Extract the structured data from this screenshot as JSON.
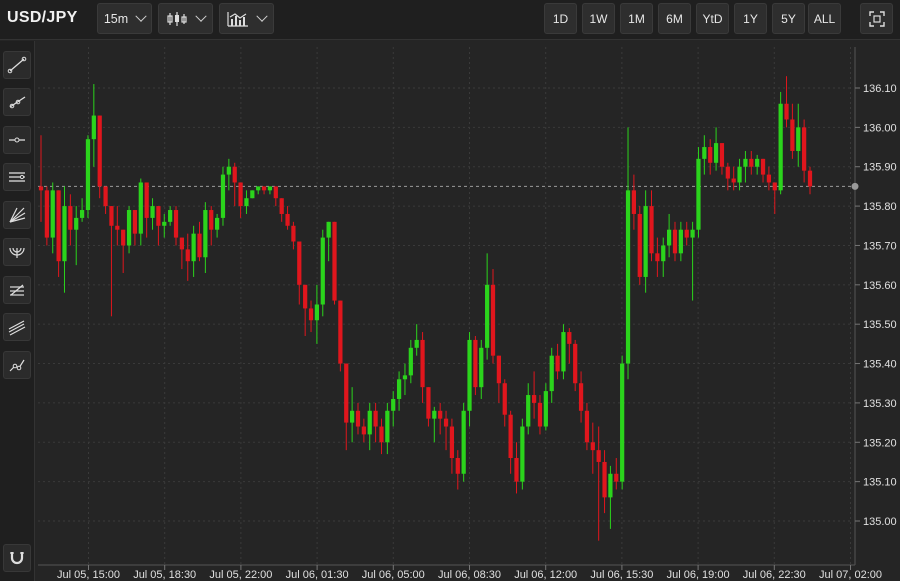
{
  "header": {
    "symbol": "USD/JPY",
    "interval": "15m",
    "chart_type_icon": "candlestick-icon",
    "indicators_icon": "indicators-icon",
    "ranges": [
      "1D",
      "1W",
      "1M",
      "6M",
      "YtD",
      "1Y",
      "5Y",
      "ALL"
    ],
    "fullscreen_icon": "fullscreen-icon"
  },
  "sidebar": {
    "tools": [
      "trend-line-icon",
      "ray-icon",
      "horizontal-line-icon",
      "parallel-channel-icon",
      "fan-icon",
      "arc-icon",
      "fib-retracement-icon",
      "channel-lines-icon",
      "path-icon"
    ],
    "bottom_tool": "magnet-icon"
  },
  "colors": {
    "background": "#252525",
    "grid": "#3a3a3a",
    "up": "#2bd41c",
    "down": "#e0161d",
    "current_price_line": "#9a9a9a"
  },
  "chart_data": {
    "type": "candlestick",
    "symbol": "USD/JPY",
    "interval": "15m",
    "ylim": [
      134.95,
      136.15
    ],
    "y_ticks": [
      "135.00",
      "135.10",
      "135.20",
      "135.30",
      "135.40",
      "135.50",
      "135.60",
      "135.70",
      "135.80",
      "135.90",
      "136.00",
      "136.10"
    ],
    "x_ticks": [
      "Jul 05, 15:00",
      "Jul 05, 18:30",
      "Jul 05, 22:00",
      "Jul 06, 01:30",
      "Jul 06, 05:00",
      "Jul 06, 08:30",
      "Jul 06, 12:00",
      "Jul 06, 15:30",
      "Jul 06, 19:00",
      "Jul 06, 22:30",
      "Jul 07, 02:00"
    ],
    "current_price": "135.85",
    "grid": true,
    "candles": [
      [
        135.85,
        135.98,
        135.76,
        135.84
      ],
      [
        135.84,
        135.85,
        135.7,
        135.72
      ],
      [
        135.72,
        135.86,
        135.68,
        135.84
      ],
      [
        135.84,
        135.84,
        135.62,
        135.66
      ],
      [
        135.66,
        135.85,
        135.58,
        135.8
      ],
      [
        135.8,
        135.83,
        135.7,
        135.74
      ],
      [
        135.74,
        135.8,
        135.65,
        135.77
      ],
      [
        135.77,
        135.82,
        135.76,
        135.79
      ],
      [
        135.79,
        135.98,
        135.77,
        135.97
      ],
      [
        135.97,
        136.11,
        135.9,
        136.03
      ],
      [
        136.03,
        136.03,
        135.82,
        135.85
      ],
      [
        135.85,
        135.85,
        135.78,
        135.8
      ],
      [
        135.8,
        135.8,
        135.52,
        135.75
      ],
      [
        135.75,
        135.8,
        135.7,
        135.74
      ],
      [
        135.74,
        135.74,
        135.63,
        135.7
      ],
      [
        135.7,
        135.8,
        135.68,
        135.79
      ],
      [
        135.79,
        135.79,
        135.7,
        135.73
      ],
      [
        135.73,
        135.87,
        135.7,
        135.86
      ],
      [
        135.86,
        135.86,
        135.72,
        135.77
      ],
      [
        135.77,
        135.82,
        135.74,
        135.8
      ],
      [
        135.8,
        135.8,
        135.7,
        135.75
      ],
      [
        135.75,
        135.78,
        135.72,
        135.76
      ],
      [
        135.76,
        135.8,
        135.75,
        135.79
      ],
      [
        135.79,
        135.8,
        135.7,
        135.72
      ],
      [
        135.72,
        135.72,
        135.64,
        135.69
      ],
      [
        135.69,
        135.73,
        135.61,
        135.66
      ],
      [
        135.66,
        135.75,
        135.62,
        135.73
      ],
      [
        135.73,
        135.76,
        135.66,
        135.67
      ],
      [
        135.67,
        135.81,
        135.63,
        135.79
      ],
      [
        135.79,
        135.8,
        135.7,
        135.74
      ],
      [
        135.74,
        135.78,
        135.72,
        135.77
      ],
      [
        135.77,
        135.9,
        135.75,
        135.88
      ],
      [
        135.88,
        135.92,
        135.84,
        135.9
      ],
      [
        135.9,
        135.91,
        135.8,
        135.86
      ],
      [
        135.86,
        135.86,
        135.77,
        135.8
      ],
      [
        135.8,
        135.84,
        135.78,
        135.82
      ],
      [
        135.82,
        135.84,
        135.82,
        135.84
      ],
      [
        135.84,
        135.85,
        135.83,
        135.85
      ],
      [
        135.85,
        135.85,
        135.83,
        135.84
      ],
      [
        135.84,
        135.85,
        135.83,
        135.85
      ],
      [
        135.85,
        135.85,
        135.8,
        135.82
      ],
      [
        135.82,
        135.82,
        135.76,
        135.78
      ],
      [
        135.78,
        135.8,
        135.74,
        135.75
      ],
      [
        135.75,
        135.76,
        135.69,
        135.71
      ],
      [
        135.71,
        135.71,
        135.55,
        135.6
      ],
      [
        135.6,
        135.6,
        135.47,
        135.54
      ],
      [
        135.54,
        135.56,
        135.48,
        135.51
      ],
      [
        135.51,
        135.6,
        135.45,
        135.55
      ],
      [
        135.55,
        135.74,
        135.52,
        135.72
      ],
      [
        135.72,
        135.76,
        135.66,
        135.76
      ],
      [
        135.76,
        135.76,
        135.55,
        135.56
      ],
      [
        135.56,
        135.56,
        135.38,
        135.4
      ],
      [
        135.4,
        135.4,
        135.18,
        135.25
      ],
      [
        135.25,
        135.34,
        135.2,
        135.28
      ],
      [
        135.28,
        135.3,
        135.22,
        135.24
      ],
      [
        135.24,
        135.26,
        135.2,
        135.22
      ],
      [
        135.22,
        135.3,
        135.18,
        135.28
      ],
      [
        135.28,
        135.3,
        135.2,
        135.24
      ],
      [
        135.24,
        135.26,
        135.17,
        135.2
      ],
      [
        135.2,
        135.3,
        135.17,
        135.28
      ],
      [
        135.28,
        135.33,
        135.24,
        135.31
      ],
      [
        135.31,
        135.38,
        135.28,
        135.36
      ],
      [
        135.36,
        135.4,
        135.32,
        135.37
      ],
      [
        135.37,
        135.46,
        135.35,
        135.44
      ],
      [
        135.44,
        135.5,
        135.42,
        135.46
      ],
      [
        135.46,
        135.48,
        135.3,
        135.34
      ],
      [
        135.34,
        135.34,
        135.24,
        135.26
      ],
      [
        135.26,
        135.29,
        135.2,
        135.28
      ],
      [
        135.28,
        135.3,
        135.22,
        135.26
      ],
      [
        135.26,
        135.28,
        135.18,
        135.24
      ],
      [
        135.24,
        135.26,
        135.12,
        135.16
      ],
      [
        135.16,
        135.18,
        135.08,
        135.12
      ],
      [
        135.12,
        135.3,
        135.1,
        135.28
      ],
      [
        135.28,
        135.48,
        135.24,
        135.46
      ],
      [
        135.46,
        135.47,
        135.32,
        135.34
      ],
      [
        135.34,
        135.46,
        135.31,
        135.44
      ],
      [
        135.44,
        135.68,
        135.41,
        135.6
      ],
      [
        135.6,
        135.64,
        135.4,
        135.42
      ],
      [
        135.42,
        135.42,
        135.3,
        135.35
      ],
      [
        135.35,
        135.36,
        135.24,
        135.27
      ],
      [
        135.27,
        135.28,
        135.12,
        135.16
      ],
      [
        135.16,
        135.2,
        135.07,
        135.1
      ],
      [
        135.1,
        135.26,
        135.08,
        135.24
      ],
      [
        135.24,
        135.35,
        135.22,
        135.32
      ],
      [
        135.32,
        135.38,
        135.26,
        135.3
      ],
      [
        135.3,
        135.32,
        135.22,
        135.24
      ],
      [
        135.24,
        135.35,
        135.23,
        135.33
      ],
      [
        135.33,
        135.44,
        135.3,
        135.42
      ],
      [
        135.42,
        135.45,
        135.36,
        135.38
      ],
      [
        135.38,
        135.5,
        135.36,
        135.48
      ],
      [
        135.48,
        135.49,
        135.4,
        135.45
      ],
      [
        135.45,
        135.46,
        135.33,
        135.35
      ],
      [
        135.35,
        135.38,
        135.25,
        135.28
      ],
      [
        135.28,
        135.3,
        135.18,
        135.2
      ],
      [
        135.2,
        135.25,
        135.12,
        135.18
      ],
      [
        135.18,
        135.24,
        134.95,
        135.15
      ],
      [
        135.15,
        135.18,
        135.02,
        135.06
      ],
      [
        135.06,
        135.14,
        134.98,
        135.12
      ],
      [
        135.12,
        135.16,
        135.08,
        135.1
      ],
      [
        135.1,
        135.42,
        135.08,
        135.4
      ],
      [
        135.4,
        136.0,
        135.36,
        135.84
      ],
      [
        135.84,
        135.88,
        135.74,
        135.78
      ],
      [
        135.78,
        135.8,
        135.6,
        135.62
      ],
      [
        135.62,
        135.84,
        135.58,
        135.8
      ],
      [
        135.8,
        135.84,
        135.66,
        135.68
      ],
      [
        135.68,
        135.72,
        135.62,
        135.66
      ],
      [
        135.66,
        135.72,
        135.62,
        135.7
      ],
      [
        135.7,
        135.78,
        135.67,
        135.74
      ],
      [
        135.74,
        135.76,
        135.66,
        135.68
      ],
      [
        135.68,
        135.76,
        135.66,
        135.74
      ],
      [
        135.74,
        135.76,
        135.7,
        135.72
      ],
      [
        135.72,
        135.76,
        135.56,
        135.74
      ],
      [
        135.74,
        135.95,
        135.72,
        135.92
      ],
      [
        135.92,
        135.98,
        135.88,
        135.95
      ],
      [
        135.95,
        135.97,
        135.88,
        135.91
      ],
      [
        135.91,
        136.0,
        135.89,
        135.96
      ],
      [
        135.96,
        135.96,
        135.88,
        135.9
      ],
      [
        135.9,
        135.91,
        135.84,
        135.87
      ],
      [
        135.87,
        135.9,
        135.84,
        135.86
      ],
      [
        135.86,
        135.92,
        135.84,
        135.9
      ],
      [
        135.9,
        135.94,
        135.86,
        135.92
      ],
      [
        135.92,
        135.94,
        135.88,
        135.9
      ],
      [
        135.9,
        135.93,
        135.88,
        135.92
      ],
      [
        135.92,
        135.92,
        135.86,
        135.88
      ],
      [
        135.88,
        135.9,
        135.84,
        135.86
      ],
      [
        135.86,
        135.86,
        135.78,
        135.84
      ],
      [
        135.84,
        136.09,
        135.83,
        136.06
      ],
      [
        136.06,
        136.13,
        136.0,
        136.02
      ],
      [
        136.02,
        136.06,
        135.92,
        135.94
      ],
      [
        135.94,
        136.06,
        135.9,
        136.0
      ],
      [
        136.0,
        136.02,
        135.86,
        135.89
      ],
      [
        135.89,
        135.9,
        135.83,
        135.85
      ]
    ]
  }
}
